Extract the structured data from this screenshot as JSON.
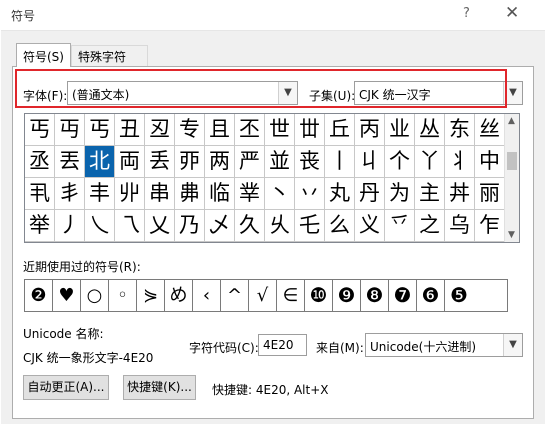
{
  "window": {
    "title": "符号",
    "help_glyph": "?",
    "close_glyph": "✕"
  },
  "tabs": [
    {
      "label": "符号(S)",
      "active": true
    },
    {
      "label": "特殊字符(P)",
      "active": false
    }
  ],
  "font": {
    "label": "字体(F):",
    "value": "(普通文本)"
  },
  "subset": {
    "label": "子集(U):",
    "value": "CJK 统一汉字"
  },
  "symbol_grid": {
    "cells": [
      "丐",
      "丏",
      "丐",
      "丑",
      "丒",
      "专",
      "且",
      "丕",
      "世",
      "丗",
      "丘",
      "丙",
      "业",
      "丛",
      "东",
      "丝",
      "丞",
      "丟",
      "北",
      "両",
      "丢",
      "丣",
      "两",
      "严",
      "並",
      "丧",
      "丨",
      "丩",
      "个",
      "丫",
      "丬",
      "中",
      "丮",
      "丯",
      "丰",
      "丱",
      "串",
      "丳",
      "临",
      "丵",
      "丶",
      "丷",
      "丸",
      "丹",
      "为",
      "主",
      "丼",
      "丽",
      "举",
      "丿",
      "乀",
      "乁",
      "乂",
      "乃",
      "乄",
      "久",
      "乆",
      "乇",
      "么",
      "义",
      "乊",
      "之",
      "乌",
      "乍"
    ],
    "selected_index": 18
  },
  "recent": {
    "label": "近期使用过的符号(R):",
    "symbols": [
      "❷",
      "♥",
      "○",
      "◦",
      "⋟",
      "め",
      "‹",
      "^",
      "√",
      "∈",
      "❿",
      "❾",
      "❽",
      "❼",
      "❻",
      "❺"
    ]
  },
  "unicode": {
    "name_label": "Unicode 名称:",
    "name_value": "CJK 统一象形文字-4E20"
  },
  "char_code": {
    "label": "字符代码(C):",
    "value": "4E20"
  },
  "from": {
    "label": "来自(M):",
    "value": "Unicode(十六进制)"
  },
  "buttons": {
    "autocorrect": "自动更正(A)...",
    "shortcut": "快捷键(K)..."
  },
  "shortcut_info": "快捷键: 4E20, Alt+X",
  "colors": {
    "highlight": "#e0262b",
    "selection": "#0a64ad"
  }
}
